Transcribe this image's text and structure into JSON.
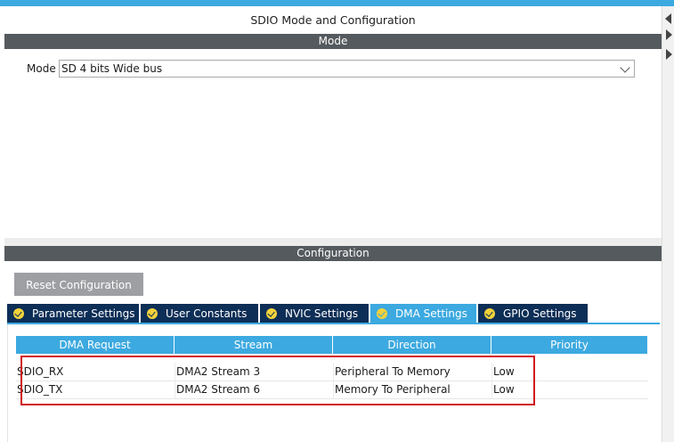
{
  "panel": {
    "title": "SDIO Mode and Configuration"
  },
  "mode_section": {
    "header": "Mode",
    "label": "Mode",
    "selected": "SD 4 bits Wide bus"
  },
  "config_section": {
    "header": "Configuration",
    "reset_label": "Reset Configuration",
    "tabs": [
      {
        "label": "Parameter Settings",
        "active": false
      },
      {
        "label": "User Constants",
        "active": false
      },
      {
        "label": "NVIC Settings",
        "active": false
      },
      {
        "label": "DMA Settings",
        "active": true
      },
      {
        "label": "GPIO Settings",
        "active": false
      }
    ]
  },
  "dma_table": {
    "columns": [
      "DMA Request",
      "Stream",
      "Direction",
      "Priority"
    ],
    "rows": [
      [
        "SDIO_RX",
        "DMA2 Stream 3",
        "Peripheral To Memory",
        "Low"
      ],
      [
        "SDIO_TX",
        "DMA2 Stream 6",
        "Memory To Peripheral",
        "Low"
      ]
    ]
  },
  "colors": {
    "accent": "#3ca9e0",
    "tab_dark": "#0d2e56",
    "section_bar": "#555a5e",
    "check_yellow": "#f3d23b",
    "highlight_red": "#d0191c"
  }
}
